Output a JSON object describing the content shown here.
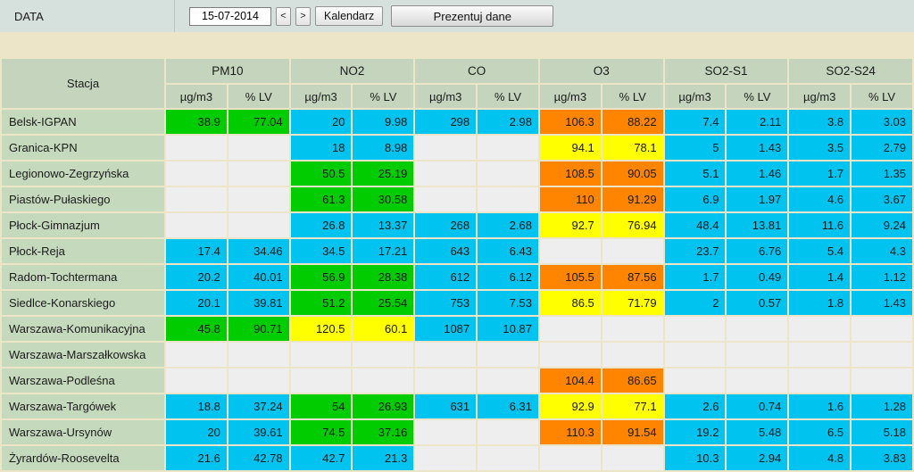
{
  "toolbar": {
    "label": "DATA",
    "date_value": "15-07-2014",
    "date_placeholder": "dd-mm-rrrr",
    "prev_label": "<",
    "next_label": ">",
    "calendar_label": "Kalendarz",
    "present_label": "Prezentuj dane"
  },
  "table": {
    "station_header": "Stacja",
    "groups": [
      "PM10",
      "NO2",
      "CO",
      "O3",
      "SO2-S1",
      "SO2-S24"
    ],
    "unit_headers": [
      "µg/m3",
      "% LV"
    ],
    "colors": {
      "green": "#00cc00",
      "cyan": "#00c3f0",
      "yellow": "#ffff00",
      "orange": "#ff8400",
      "empty": "#eeeeee",
      "station": "#c5d9bc",
      "header": "#c5d5bd",
      "page_bg": "#ede5c8",
      "toolbar_bg": "#d6e0dc"
    },
    "rows": [
      {
        "station": "Belsk-IGPAN",
        "cells": [
          {
            "v": "38.9",
            "c": "green"
          },
          {
            "v": "77.04",
            "c": "green"
          },
          {
            "v": "20",
            "c": "cyan"
          },
          {
            "v": "9.98",
            "c": "cyan"
          },
          {
            "v": "298",
            "c": "cyan"
          },
          {
            "v": "2.98",
            "c": "cyan"
          },
          {
            "v": "106.3",
            "c": "orange"
          },
          {
            "v": "88.22",
            "c": "orange"
          },
          {
            "v": "7.4",
            "c": "cyan"
          },
          {
            "v": "2.11",
            "c": "cyan"
          },
          {
            "v": "3.8",
            "c": "cyan"
          },
          {
            "v": "3.03",
            "c": "cyan"
          }
        ]
      },
      {
        "station": "Granica-KPN",
        "cells": [
          {
            "v": "",
            "c": "empty"
          },
          {
            "v": "",
            "c": "empty"
          },
          {
            "v": "18",
            "c": "cyan"
          },
          {
            "v": "8.98",
            "c": "cyan"
          },
          {
            "v": "",
            "c": "empty"
          },
          {
            "v": "",
            "c": "empty"
          },
          {
            "v": "94.1",
            "c": "yellow"
          },
          {
            "v": "78.1",
            "c": "yellow"
          },
          {
            "v": "5",
            "c": "cyan"
          },
          {
            "v": "1.43",
            "c": "cyan"
          },
          {
            "v": "3.5",
            "c": "cyan"
          },
          {
            "v": "2.79",
            "c": "cyan"
          }
        ]
      },
      {
        "station": "Legionowo-Zegrzyńska",
        "cells": [
          {
            "v": "",
            "c": "empty"
          },
          {
            "v": "",
            "c": "empty"
          },
          {
            "v": "50.5",
            "c": "green"
          },
          {
            "v": "25.19",
            "c": "green"
          },
          {
            "v": "",
            "c": "empty"
          },
          {
            "v": "",
            "c": "empty"
          },
          {
            "v": "108.5",
            "c": "orange"
          },
          {
            "v": "90.05",
            "c": "orange"
          },
          {
            "v": "5.1",
            "c": "cyan"
          },
          {
            "v": "1.46",
            "c": "cyan"
          },
          {
            "v": "1.7",
            "c": "cyan"
          },
          {
            "v": "1.35",
            "c": "cyan"
          }
        ]
      },
      {
        "station": "Piastów-Pułaskiego",
        "cells": [
          {
            "v": "",
            "c": "empty"
          },
          {
            "v": "",
            "c": "empty"
          },
          {
            "v": "61.3",
            "c": "green"
          },
          {
            "v": "30.58",
            "c": "green"
          },
          {
            "v": "",
            "c": "empty"
          },
          {
            "v": "",
            "c": "empty"
          },
          {
            "v": "110",
            "c": "orange"
          },
          {
            "v": "91.29",
            "c": "orange"
          },
          {
            "v": "6.9",
            "c": "cyan"
          },
          {
            "v": "1.97",
            "c": "cyan"
          },
          {
            "v": "4.6",
            "c": "cyan"
          },
          {
            "v": "3.67",
            "c": "cyan"
          }
        ]
      },
      {
        "station": "Płock-Gimnazjum",
        "cells": [
          {
            "v": "",
            "c": "empty"
          },
          {
            "v": "",
            "c": "empty"
          },
          {
            "v": "26.8",
            "c": "cyan"
          },
          {
            "v": "13.37",
            "c": "cyan"
          },
          {
            "v": "268",
            "c": "cyan"
          },
          {
            "v": "2.68",
            "c": "cyan"
          },
          {
            "v": "92.7",
            "c": "yellow"
          },
          {
            "v": "76.94",
            "c": "yellow"
          },
          {
            "v": "48.4",
            "c": "cyan"
          },
          {
            "v": "13.81",
            "c": "cyan"
          },
          {
            "v": "11.6",
            "c": "cyan"
          },
          {
            "v": "9.24",
            "c": "cyan"
          }
        ]
      },
      {
        "station": "Płock-Reja",
        "cells": [
          {
            "v": "17.4",
            "c": "cyan"
          },
          {
            "v": "34.46",
            "c": "cyan"
          },
          {
            "v": "34.5",
            "c": "cyan"
          },
          {
            "v": "17.21",
            "c": "cyan"
          },
          {
            "v": "643",
            "c": "cyan"
          },
          {
            "v": "6.43",
            "c": "cyan"
          },
          {
            "v": "",
            "c": "empty"
          },
          {
            "v": "",
            "c": "empty"
          },
          {
            "v": "23.7",
            "c": "cyan"
          },
          {
            "v": "6.76",
            "c": "cyan"
          },
          {
            "v": "5.4",
            "c": "cyan"
          },
          {
            "v": "4.3",
            "c": "cyan"
          }
        ]
      },
      {
        "station": "Radom-Tochtermana",
        "cells": [
          {
            "v": "20.2",
            "c": "cyan"
          },
          {
            "v": "40.01",
            "c": "cyan"
          },
          {
            "v": "56.9",
            "c": "green"
          },
          {
            "v": "28.38",
            "c": "green"
          },
          {
            "v": "612",
            "c": "cyan"
          },
          {
            "v": "6.12",
            "c": "cyan"
          },
          {
            "v": "105.5",
            "c": "orange"
          },
          {
            "v": "87.56",
            "c": "orange"
          },
          {
            "v": "1.7",
            "c": "cyan"
          },
          {
            "v": "0.49",
            "c": "cyan"
          },
          {
            "v": "1.4",
            "c": "cyan"
          },
          {
            "v": "1.12",
            "c": "cyan"
          }
        ]
      },
      {
        "station": "Siedlce-Konarskiego",
        "cells": [
          {
            "v": "20.1",
            "c": "cyan"
          },
          {
            "v": "39.81",
            "c": "cyan"
          },
          {
            "v": "51.2",
            "c": "green"
          },
          {
            "v": "25.54",
            "c": "green"
          },
          {
            "v": "753",
            "c": "cyan"
          },
          {
            "v": "7.53",
            "c": "cyan"
          },
          {
            "v": "86.5",
            "c": "yellow"
          },
          {
            "v": "71.79",
            "c": "yellow"
          },
          {
            "v": "2",
            "c": "cyan"
          },
          {
            "v": "0.57",
            "c": "cyan"
          },
          {
            "v": "1.8",
            "c": "cyan"
          },
          {
            "v": "1.43",
            "c": "cyan"
          }
        ]
      },
      {
        "station": "Warszawa-Komunikacyjna",
        "cells": [
          {
            "v": "45.8",
            "c": "green"
          },
          {
            "v": "90.71",
            "c": "green"
          },
          {
            "v": "120.5",
            "c": "yellow"
          },
          {
            "v": "60.1",
            "c": "yellow"
          },
          {
            "v": "1087",
            "c": "cyan"
          },
          {
            "v": "10.87",
            "c": "cyan"
          },
          {
            "v": "",
            "c": "empty"
          },
          {
            "v": "",
            "c": "empty"
          },
          {
            "v": "",
            "c": "empty"
          },
          {
            "v": "",
            "c": "empty"
          },
          {
            "v": "",
            "c": "empty"
          },
          {
            "v": "",
            "c": "empty"
          }
        ]
      },
      {
        "station": "Warszawa-Marszałkowska",
        "cells": [
          {
            "v": "",
            "c": "empty"
          },
          {
            "v": "",
            "c": "empty"
          },
          {
            "v": "",
            "c": "empty"
          },
          {
            "v": "",
            "c": "empty"
          },
          {
            "v": "",
            "c": "empty"
          },
          {
            "v": "",
            "c": "empty"
          },
          {
            "v": "",
            "c": "empty"
          },
          {
            "v": "",
            "c": "empty"
          },
          {
            "v": "",
            "c": "empty"
          },
          {
            "v": "",
            "c": "empty"
          },
          {
            "v": "",
            "c": "empty"
          },
          {
            "v": "",
            "c": "empty"
          }
        ]
      },
      {
        "station": "Warszawa-Podleśna",
        "cells": [
          {
            "v": "",
            "c": "empty"
          },
          {
            "v": "",
            "c": "empty"
          },
          {
            "v": "",
            "c": "empty"
          },
          {
            "v": "",
            "c": "empty"
          },
          {
            "v": "",
            "c": "empty"
          },
          {
            "v": "",
            "c": "empty"
          },
          {
            "v": "104.4",
            "c": "orange"
          },
          {
            "v": "86.65",
            "c": "orange"
          },
          {
            "v": "",
            "c": "empty"
          },
          {
            "v": "",
            "c": "empty"
          },
          {
            "v": "",
            "c": "empty"
          },
          {
            "v": "",
            "c": "empty"
          }
        ]
      },
      {
        "station": "Warszawa-Targówek",
        "cells": [
          {
            "v": "18.8",
            "c": "cyan"
          },
          {
            "v": "37.24",
            "c": "cyan"
          },
          {
            "v": "54",
            "c": "green"
          },
          {
            "v": "26.93",
            "c": "green"
          },
          {
            "v": "631",
            "c": "cyan"
          },
          {
            "v": "6.31",
            "c": "cyan"
          },
          {
            "v": "92.9",
            "c": "yellow"
          },
          {
            "v": "77.1",
            "c": "yellow"
          },
          {
            "v": "2.6",
            "c": "cyan"
          },
          {
            "v": "0.74",
            "c": "cyan"
          },
          {
            "v": "1.6",
            "c": "cyan"
          },
          {
            "v": "1.28",
            "c": "cyan"
          }
        ]
      },
      {
        "station": "Warszawa-Ursynów",
        "cells": [
          {
            "v": "20",
            "c": "cyan"
          },
          {
            "v": "39.61",
            "c": "cyan"
          },
          {
            "v": "74.5",
            "c": "green"
          },
          {
            "v": "37.16",
            "c": "green"
          },
          {
            "v": "",
            "c": "empty"
          },
          {
            "v": "",
            "c": "empty"
          },
          {
            "v": "110.3",
            "c": "orange"
          },
          {
            "v": "91.54",
            "c": "orange"
          },
          {
            "v": "19.2",
            "c": "cyan"
          },
          {
            "v": "5.48",
            "c": "cyan"
          },
          {
            "v": "6.5",
            "c": "cyan"
          },
          {
            "v": "5.18",
            "c": "cyan"
          }
        ]
      },
      {
        "station": "Żyrardów-Roosevelta",
        "cells": [
          {
            "v": "21.6",
            "c": "cyan"
          },
          {
            "v": "42.78",
            "c": "cyan"
          },
          {
            "v": "42.7",
            "c": "cyan"
          },
          {
            "v": "21.3",
            "c": "cyan"
          },
          {
            "v": "",
            "c": "empty"
          },
          {
            "v": "",
            "c": "empty"
          },
          {
            "v": "",
            "c": "empty"
          },
          {
            "v": "",
            "c": "empty"
          },
          {
            "v": "10.3",
            "c": "cyan"
          },
          {
            "v": "2.94",
            "c": "cyan"
          },
          {
            "v": "4.8",
            "c": "cyan"
          },
          {
            "v": "3.83",
            "c": "cyan"
          }
        ]
      }
    ]
  }
}
